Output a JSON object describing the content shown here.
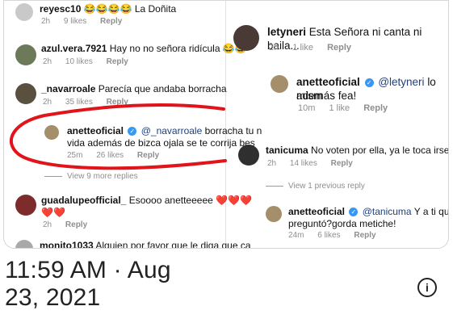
{
  "left": {
    "c1": {
      "user": "reyesc10",
      "text": "😂😂😂😂 La Doñita",
      "time": "2h",
      "likes": "9 likes",
      "reply": "Reply"
    },
    "c2": {
      "user": "azul.vera.7921",
      "text": "Hay no no señora ridícula 😂😂",
      "time": "2h",
      "likes": "10 likes",
      "reply": "Reply"
    },
    "c3": {
      "user": "_navarroale",
      "text": "Parecía que andaba borracha",
      "time": "2h",
      "likes": "35 likes",
      "reply": "Reply"
    },
    "c4": {
      "user": "anetteoficial",
      "mention": "@_navarroale",
      "text1": "borracha tu n",
      "text2": "vida además de bizca ojala se te corrija bes",
      "time": "25m",
      "likes": "26 likes",
      "reply": "Reply"
    },
    "view_more": "View 9 more replies",
    "c5": {
      "user": "guadalupeofficial_",
      "text": "Esoooo anetteeeee",
      "hearts1": "❤️❤️❤️",
      "hearts2": "❤️❤️",
      "time": "2h",
      "reply": "Reply"
    },
    "c6": {
      "user": "monito1033",
      "text": "Alguien por favor que le diga que ca"
    }
  },
  "right": {
    "c1": {
      "user": "letyneri",
      "text": "Esta Señora ni canta ni baila...",
      "time": "2h",
      "likes": "1 like",
      "reply": "Reply"
    },
    "c2": {
      "user": "anetteoficial",
      "mention": "@letyneri",
      "text1": "lo mism",
      "text2": "además fea!",
      "time": "10m",
      "likes": "1 like",
      "reply": "Reply"
    },
    "c3": {
      "user": "tanicuma",
      "text": "No voten por ella, ya le toca irse",
      "time": "2h",
      "likes": "14 likes",
      "reply": "Reply"
    },
    "view_previous": "View 1 previous reply",
    "c4": {
      "user": "anetteoficial",
      "mention": "@tanicuma",
      "text1": "Y a ti quién te",
      "text2": "preguntó?gorda metiche!",
      "time": "24m",
      "likes": "6 likes",
      "reply": "Reply"
    }
  },
  "timestamp": {
    "line1": "11:59 AM · Aug",
    "line2": "23, 2021"
  },
  "icons": {
    "info": "info-icon",
    "verified": "verified-badge-icon"
  },
  "colors": {
    "annotation": "#e0141a",
    "verified": "#3897f0"
  }
}
